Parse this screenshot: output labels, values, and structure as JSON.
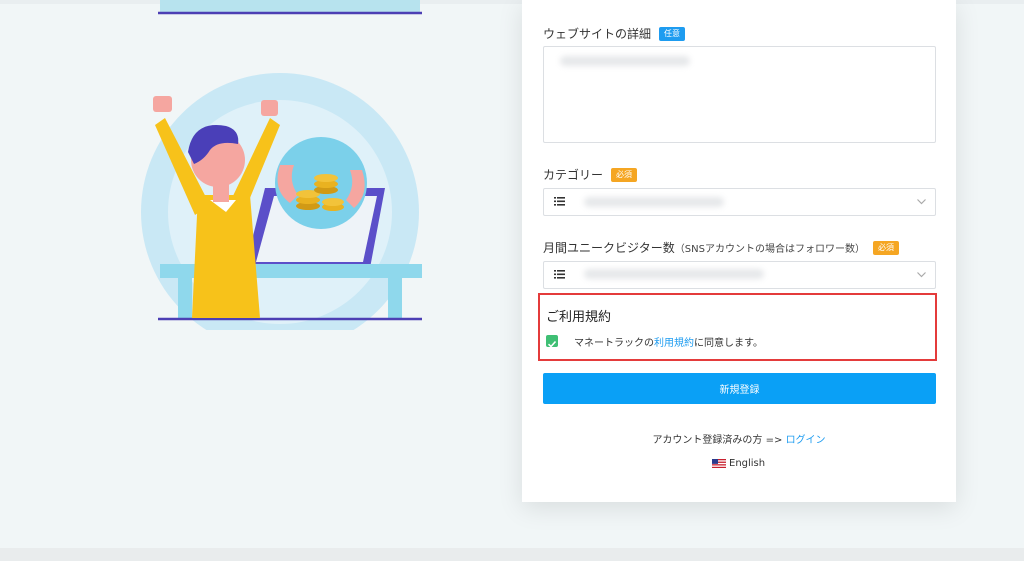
{
  "form": {
    "website_details": {
      "label": "ウェブサイトの詳細",
      "badge": "任意"
    },
    "category": {
      "label": "カテゴリー",
      "badge": "必須"
    },
    "monthly_visitors": {
      "label": "月間ユニークビジター数",
      "note": "（SNSアカウントの場合はフォロワー数）",
      "badge": "必須"
    },
    "terms": {
      "title": "ご利用規約",
      "checked": true,
      "text_before": "マネートラックの",
      "link_text": "利用規約",
      "text_after": "に同意します。"
    },
    "submit_label": "新規登録",
    "login_prompt": "アカウント登録済みの方 =>",
    "login_link": "ログイン",
    "language": "English"
  },
  "icons": {
    "list": "list-icon",
    "chevron": "chevron-down-icon",
    "check": "checkmark-icon",
    "flag": "us-flag-icon"
  },
  "colors": {
    "accent": "#0aa0f6",
    "required_badge": "#f5a623",
    "optional_badge": "#1e9cf0",
    "checkbox": "#3fbf74",
    "highlight_border": "#e43b3b"
  }
}
